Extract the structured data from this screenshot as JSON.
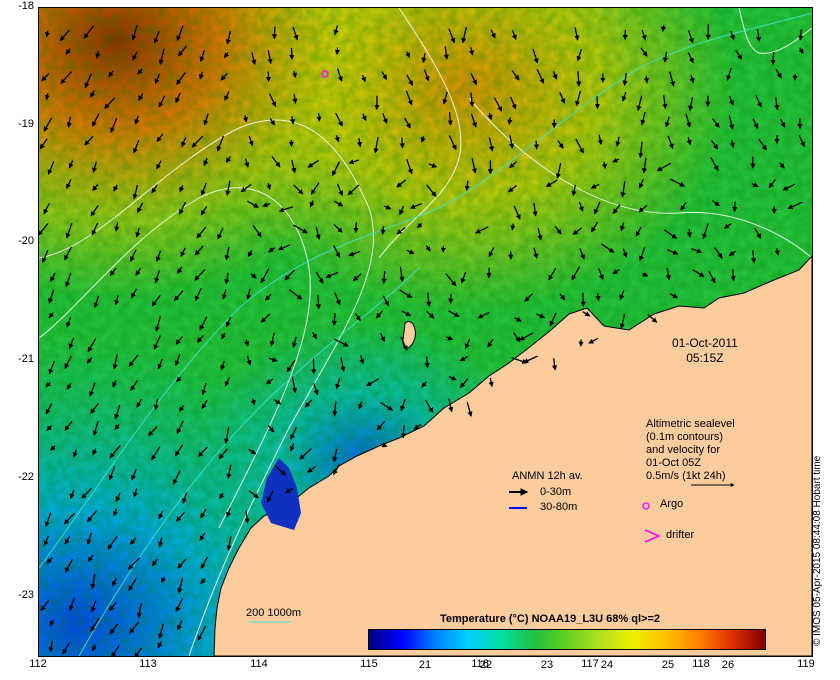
{
  "map": {
    "x_ticks": [
      "112",
      "113",
      "114",
      "115",
      "116",
      "117",
      "118",
      "119"
    ],
    "y_ticks": [
      "-18",
      "-19",
      "-20",
      "-21",
      "-22",
      "-23"
    ],
    "extent": {
      "lon": [
        112,
        119
      ],
      "lat": [
        -23.5,
        -18
      ]
    },
    "land_color": "#fbcc9e",
    "date": "01-Oct-2011",
    "time": "05:15Z"
  },
  "altimetry_note": {
    "line1": "Altimetric sealevel",
    "line2": "(0.1m contours)",
    "line3": "and velocity for",
    "line4": "01-Oct 05Z",
    "line5": "0.5m/s (1kt 24h)"
  },
  "anmn_legend": {
    "title": "ANMN 12h av.",
    "item1": "0-30m",
    "item1_color": "#000000",
    "item2": "30-80m",
    "item2_color": "#0000ff"
  },
  "argo_label": "Argo",
  "argo_color": "#ff00ff",
  "drifter_label": "drifter",
  "drifter_color": "#ff00ff",
  "bathy_label": "200  1000m",
  "bathy_color": "#40e0d0",
  "colorbar": {
    "title": "Temperature (°C) NOAA19_L3U 68% ql>=2",
    "ticks": [
      "21",
      "22",
      "23",
      "24",
      "25",
      "26"
    ],
    "range": [
      20.3,
      26.8
    ],
    "colors": [
      "#00007f",
      "#0000ff",
      "#0080ff",
      "#00d0ff",
      "#00e0a0",
      "#20c040",
      "#60d020",
      "#b0e020",
      "#f0f000",
      "#ffc000",
      "#ff8000",
      "#e03000",
      "#800000"
    ]
  },
  "credit": "© IMOS 05-Apr-2015 08:44:08 Hobart time"
}
